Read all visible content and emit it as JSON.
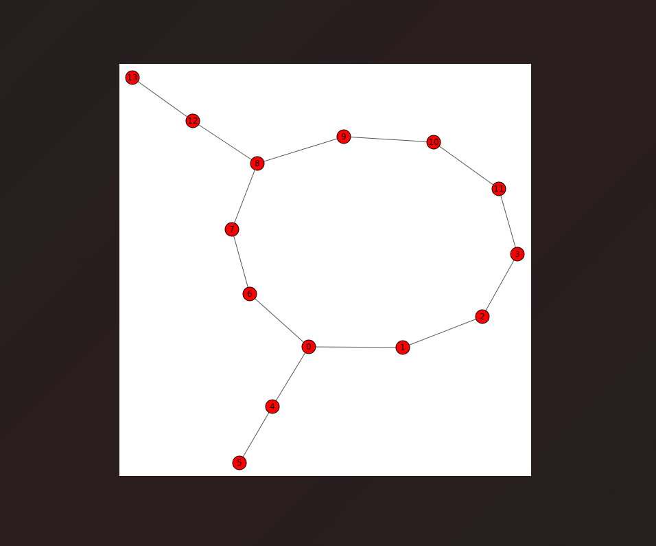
{
  "graph": {
    "node_color": "#ff0000",
    "edge_color": "#555555",
    "background": "#ffffff",
    "nodes": [
      {
        "id": "0",
        "label": "0"
      },
      {
        "id": "1",
        "label": "1"
      },
      {
        "id": "2",
        "label": "2"
      },
      {
        "id": "3",
        "label": "3"
      },
      {
        "id": "4",
        "label": "4"
      },
      {
        "id": "5",
        "label": "5"
      },
      {
        "id": "6",
        "label": "6"
      },
      {
        "id": "7",
        "label": "7"
      },
      {
        "id": "8",
        "label": "8"
      },
      {
        "id": "9",
        "label": "9"
      },
      {
        "id": "10",
        "label": "10"
      },
      {
        "id": "11",
        "label": "11"
      },
      {
        "id": "12",
        "label": "12"
      },
      {
        "id": "13",
        "label": "13"
      }
    ],
    "edges": [
      [
        "13",
        "12"
      ],
      [
        "12",
        "8"
      ],
      [
        "8",
        "9"
      ],
      [
        "9",
        "10"
      ],
      [
        "10",
        "11"
      ],
      [
        "11",
        "3"
      ],
      [
        "3",
        "2"
      ],
      [
        "2",
        "1"
      ],
      [
        "1",
        "0"
      ],
      [
        "0",
        "6"
      ],
      [
        "6",
        "7"
      ],
      [
        "7",
        "8"
      ],
      [
        "0",
        "4"
      ],
      [
        "4",
        "5"
      ]
    ]
  }
}
